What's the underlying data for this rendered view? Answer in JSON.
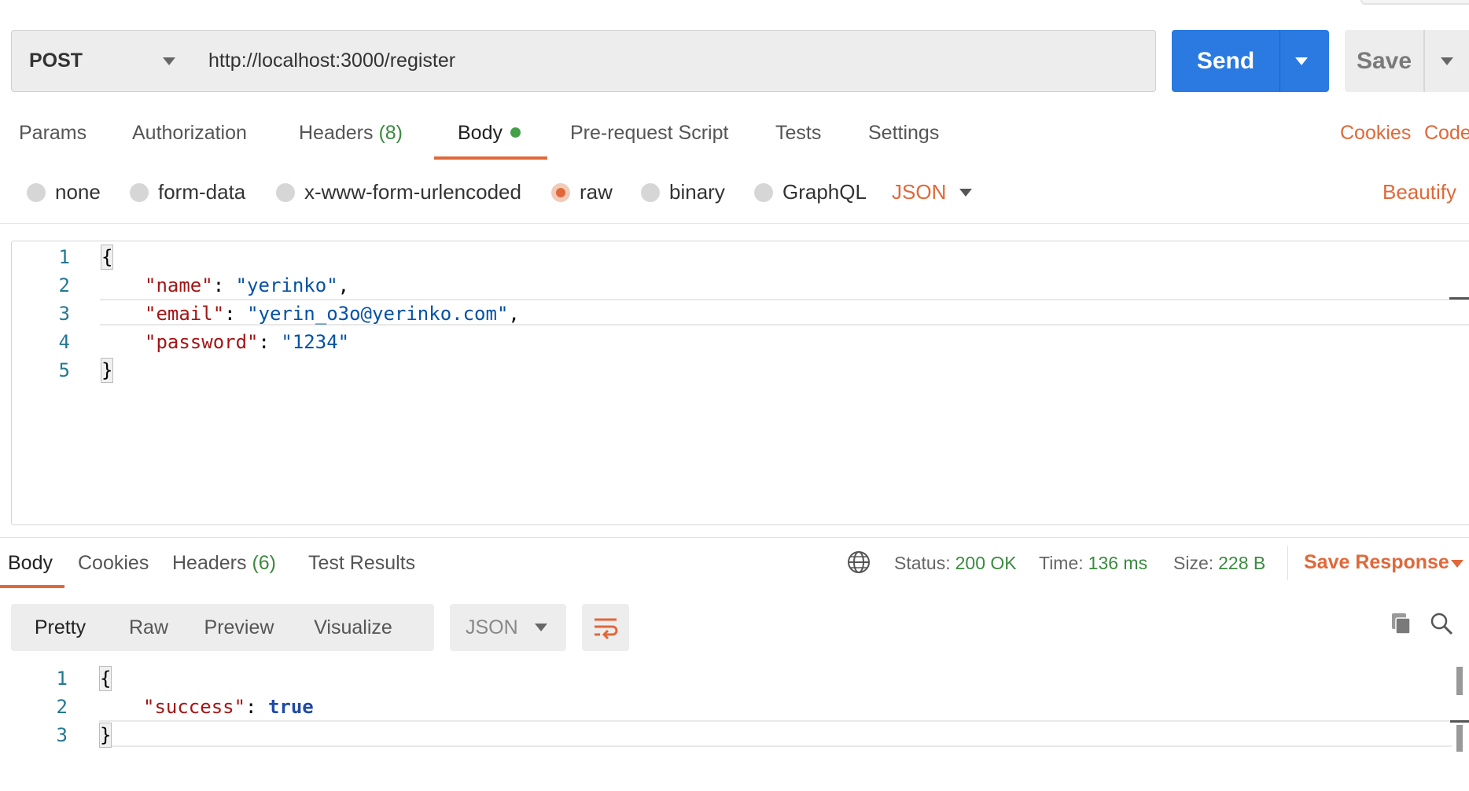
{
  "request": {
    "method": "POST",
    "url": "http://localhost:3000/register",
    "send_label": "Send",
    "save_label": "Save"
  },
  "request_tabs": {
    "params": "Params",
    "authorization": "Authorization",
    "headers": "Headers",
    "headers_count": "(8)",
    "body": "Body",
    "prerequest": "Pre-request Script",
    "tests": "Tests",
    "settings": "Settings",
    "cookies_link": "Cookies",
    "code_link": "Code"
  },
  "body_types": {
    "none": "none",
    "form_data": "form-data",
    "urlencoded": "x-www-form-urlencoded",
    "raw": "raw",
    "binary": "binary",
    "graphql": "GraphQL",
    "selected": "raw",
    "format": "JSON",
    "beautify": "Beautify"
  },
  "request_body": {
    "line_numbers": [
      "1",
      "2",
      "3",
      "4",
      "5"
    ],
    "open_brace": "{",
    "close_brace": "}",
    "k_name": "\"name\"",
    "v_name": "\"yerinko\"",
    "k_email": "\"email\"",
    "v_email": "\"yerin_o3o@yerinko.com\"",
    "k_password": "\"password\"",
    "v_password": "\"1234\"",
    "colon": ": ",
    "comma": ","
  },
  "response_tabs": {
    "body": "Body",
    "cookies": "Cookies",
    "headers": "Headers",
    "headers_count": "(6)",
    "test_results": "Test Results"
  },
  "response_status": {
    "status_label": "Status:",
    "status_value": "200 OK",
    "time_label": "Time:",
    "time_value": "136 ms",
    "size_label": "Size:",
    "size_value": "228 B",
    "save_response": "Save Response"
  },
  "response_view": {
    "pretty": "Pretty",
    "raw": "Raw",
    "preview": "Preview",
    "visualize": "Visualize",
    "format": "JSON"
  },
  "response_body": {
    "line_numbers": [
      "1",
      "2",
      "3"
    ],
    "open_brace": "{",
    "close_brace": "}",
    "k_success": "\"success\"",
    "v_success": "true",
    "colon": ": "
  },
  "colors": {
    "accent_orange": "#e0683a",
    "send_blue": "#2a7ae2",
    "success_green": "#3b8a3e"
  }
}
